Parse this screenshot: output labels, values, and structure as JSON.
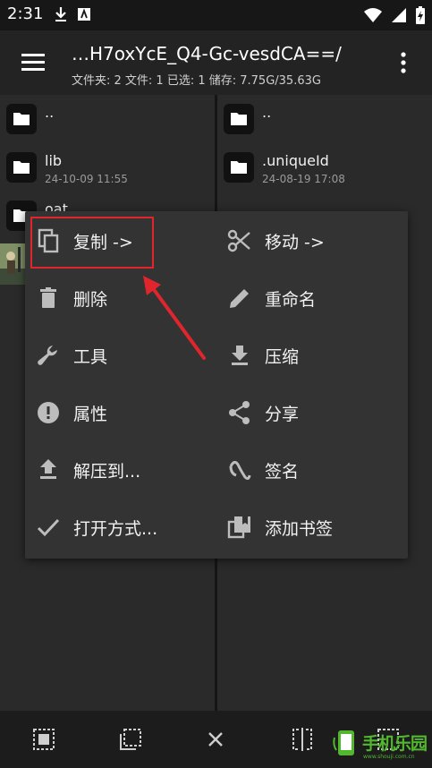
{
  "status_bar": {
    "time": "2:31",
    "icons": [
      "download-icon",
      "app-a-icon",
      "wifi-icon",
      "signal-icon",
      "battery-charging-icon"
    ]
  },
  "toolbar": {
    "path_title": "…H7oxYcE_Q4-Gc-vesdCA==/",
    "path_info": "文件夹: 2  文件: 1  已选: 1  储存: 7.75G/35.63G"
  },
  "left_pane": {
    "items": [
      {
        "name": "..",
        "date": ""
      },
      {
        "name": "lib",
        "date": "24-10-09 11:55"
      },
      {
        "name": "oat",
        "date": ""
      }
    ]
  },
  "right_pane": {
    "items": [
      {
        "name": "..",
        "date": ""
      },
      {
        "name": ".uniqueId",
        "date": "24-08-19 17:08"
      }
    ]
  },
  "context_menu": {
    "left_items": [
      {
        "label": "复制 ->",
        "icon": "copy-icon"
      },
      {
        "label": "删除",
        "icon": "trash-icon"
      },
      {
        "label": "工具",
        "icon": "wrench-icon"
      },
      {
        "label": "属性",
        "icon": "info-icon"
      },
      {
        "label": "解压到...",
        "icon": "extract-icon"
      },
      {
        "label": "打开方式...",
        "icon": "check-icon"
      }
    ],
    "right_items": [
      {
        "label": "移动 ->",
        "icon": "scissors-icon"
      },
      {
        "label": "重命名",
        "icon": "pencil-icon"
      },
      {
        "label": "压缩",
        "icon": "compress-icon"
      },
      {
        "label": "分享",
        "icon": "share-icon"
      },
      {
        "label": "签名",
        "icon": "signature-icon"
      },
      {
        "label": "添加书签",
        "icon": "bookmark-icon"
      }
    ]
  },
  "bottom_bar": {
    "buttons": [
      "select-all-icon",
      "select-inverse-icon",
      "close-icon",
      "compare-icon",
      "grid-icon"
    ]
  },
  "watermark": {
    "text": "手机乐园",
    "sub": "www.shouji.com.cn"
  },
  "colors": {
    "highlight": "#e0262c",
    "watermark": "#52b72e"
  }
}
